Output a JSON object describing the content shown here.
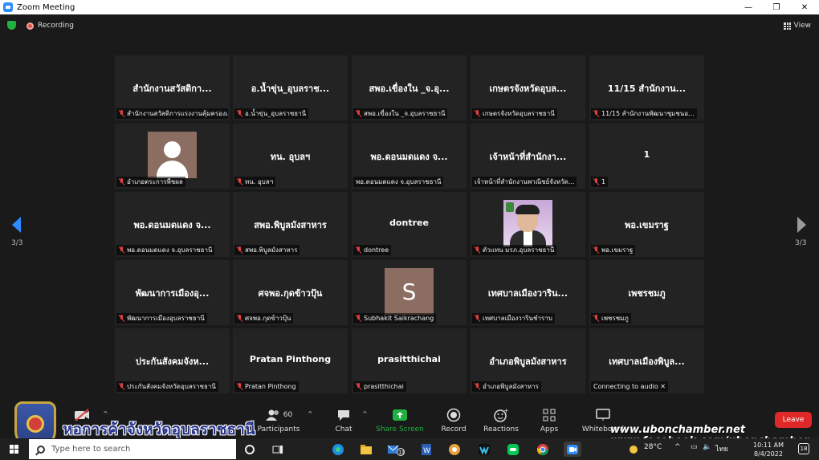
{
  "window": {
    "title": "Zoom Meeting",
    "minimize": "—",
    "maximize": "❐",
    "close": "✕"
  },
  "topbar": {
    "recording": "Recording",
    "view": "View"
  },
  "pager": {
    "left": "3/3",
    "right": "3/3"
  },
  "tiles": [
    {
      "name": "สำนักงานสวัสดิกา...",
      "label": "สำนักงานสวัสดิการแรงงานคุ้มครองแ...",
      "muted": true,
      "avatar": "none"
    },
    {
      "name": "อ.น้ำขุ่น_อุบลราช...",
      "label": "อ.น้ำขุ่น_อุบลราชธานี",
      "muted": true,
      "avatar": "none"
    },
    {
      "name": "สพอ.เขื่องใน _จ.อุ...",
      "label": "สพอ.เขื่องใน _จ.อุบลราชธานี",
      "muted": true,
      "avatar": "none"
    },
    {
      "name": "เกษตรจังหวัดอุบล...",
      "label": "เกษตรจังหวัดอุบลราชธานี",
      "muted": true,
      "avatar": "none"
    },
    {
      "name": "11/15 สำนักงาน...",
      "label": "11/15 สำนักงานพัฒนาชุมชนอ...",
      "muted": true,
      "avatar": "none"
    },
    {
      "name": "",
      "label": "อำเภอตระการพืชผล",
      "muted": true,
      "avatar": "default"
    },
    {
      "name": "ทน. อุบลฯ",
      "label": "ทน. อุบลฯ",
      "muted": true,
      "avatar": "none"
    },
    {
      "name": "พอ.ดอนมดแดง จ...",
      "label": "พอ.ดอนมดแดง จ.อุบลราชธานี",
      "muted": false,
      "avatar": "none"
    },
    {
      "name": "เจ้าหน้าที่สำนักงา...",
      "label": "เจ้าหน้าที่สำนักงานพาณิชย์จังหวัด...",
      "muted": false,
      "avatar": "none"
    },
    {
      "name": "1",
      "label": "1",
      "muted": true,
      "avatar": "none"
    },
    {
      "name": "พอ.ดอนมดแดง จ...",
      "label": "พอ.ดอนมดแดง จ.อุบลราชธานี",
      "muted": true,
      "avatar": "none"
    },
    {
      "name": "สพอ.พิบูลมังสาหาร",
      "label": "สพอ.พิบูลมังสาหาร",
      "muted": true,
      "avatar": "none"
    },
    {
      "name": "dontree",
      "label": "dontree",
      "muted": true,
      "avatar": "none"
    },
    {
      "name": "",
      "label": "ตัวแทน มรภ.อุบลราชธานี",
      "muted": true,
      "avatar": "photo"
    },
    {
      "name": "พอ.เขมราฐ",
      "label": "พอ.เขมราฐ",
      "muted": true,
      "avatar": "none"
    },
    {
      "name": "พัฒนาการเมืองอุ...",
      "label": "พัฒนาการเมืองอุบลราชธานี",
      "muted": true,
      "avatar": "none"
    },
    {
      "name": "ศจพอ.กุดข้าวปุ้น",
      "label": "ศจพอ.กุดข้าวปุ้น",
      "muted": true,
      "avatar": "none"
    },
    {
      "name": "",
      "label": "Subhakit Saikrachang",
      "muted": true,
      "avatar": "S"
    },
    {
      "name": "เทศบาลเมืองวาริน...",
      "label": "เทศบาลเมืองวารินชำราบ",
      "muted": true,
      "avatar": "none"
    },
    {
      "name": "เพชรชมภู",
      "label": "เพชรชมภู",
      "muted": true,
      "avatar": "none"
    },
    {
      "name": "ประกันสังคมจังห...",
      "label": "ประกันสังคมจังหวัดอุบลราชธานี",
      "muted": true,
      "avatar": "none"
    },
    {
      "name": "Pratan Pinthong",
      "label": "Pratan Pinthong",
      "muted": true,
      "avatar": "none"
    },
    {
      "name": "prasitthichai",
      "label": "prasitthichai",
      "muted": true,
      "avatar": "none"
    },
    {
      "name": "อำเภอพิบูลมังสาหาร",
      "label": "อำเภอพิบูลมังสาหาร",
      "muted": true,
      "avatar": "none"
    },
    {
      "name": "เทศบาลเมืองพิบูล...",
      "label": "Connecting to audio ✕",
      "muted": false,
      "avatar": "none"
    }
  ],
  "toolbar": {
    "participants_count": "60",
    "participants": "Participants",
    "chat": "Chat",
    "share": "Share Screen",
    "record": "Record",
    "reactions": "Reactions",
    "apps": "Apps",
    "whiteboard": "Whiteboard",
    "leave": "Leave",
    "share_color": "#1fb141",
    "leave_color": "#e02828"
  },
  "overlay": {
    "title": "หอการค้าจังหวัดอุบลราชธานี",
    "website": "www.ubonchamber.net",
    "facebook": "www.facebook.com/ubonchamber"
  },
  "taskbar": {
    "search_placeholder": "Type here to search",
    "mail_badge": "11",
    "weather": "28°C",
    "lang": "ไทย",
    "time": "10:11 AM",
    "date": "8/4/2022",
    "notifications": "18"
  }
}
